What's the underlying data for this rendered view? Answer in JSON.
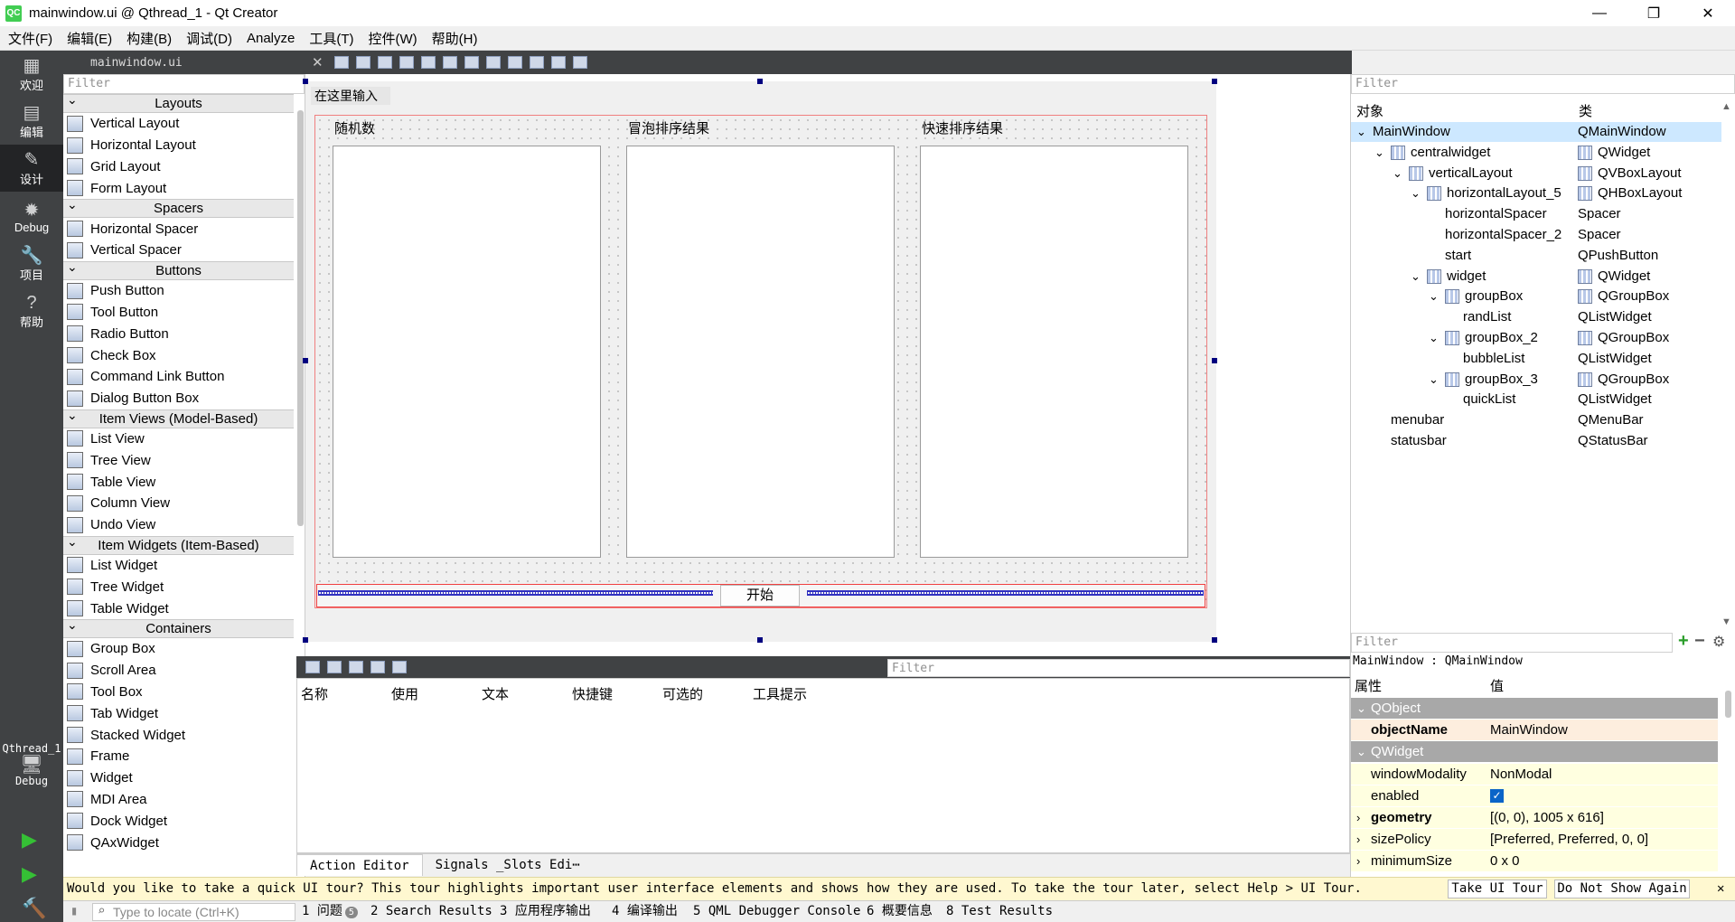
{
  "window": {
    "title": "mainwindow.ui @ Qthread_1 - Qt Creator",
    "app_icon": "QC",
    "controls": [
      "—",
      "❐",
      "✕"
    ]
  },
  "menu": [
    "文件(F)",
    "编辑(E)",
    "构建(B)",
    "调试(D)",
    "Analyze",
    "工具(T)",
    "控件(W)",
    "帮助(H)"
  ],
  "modes": [
    {
      "label": "欢迎",
      "icon": "grid-icon"
    },
    {
      "label": "编辑",
      "icon": "edit-icon"
    },
    {
      "label": "设计",
      "icon": "pencil-icon",
      "active": true
    },
    {
      "label": "Debug",
      "icon": "bug-icon"
    },
    {
      "label": "项目",
      "icon": "wrench-icon"
    },
    {
      "label": "帮助",
      "icon": "help-icon"
    }
  ],
  "kit": {
    "project": "Qthread_1",
    "build": "Debug"
  },
  "file_tab": {
    "name": "mainwindow.ui"
  },
  "widget_box": {
    "filter_placeholder": "Filter",
    "categories": [
      {
        "name": "Layouts",
        "items": [
          "Vertical Layout",
          "Horizontal Layout",
          "Grid Layout",
          "Form Layout"
        ]
      },
      {
        "name": "Spacers",
        "items": [
          "Horizontal Spacer",
          "Vertical Spacer"
        ]
      },
      {
        "name": "Buttons",
        "items": [
          "Push Button",
          "Tool Button",
          "Radio Button",
          "Check Box",
          "Command Link Button",
          "Dialog Button Box"
        ]
      },
      {
        "name": "Item Views (Model-Based)",
        "items": [
          "List View",
          "Tree View",
          "Table View",
          "Column View",
          "Undo View"
        ]
      },
      {
        "name": "Item Widgets (Item-Based)",
        "items": [
          "List Widget",
          "Tree Widget",
          "Table Widget"
        ]
      },
      {
        "name": "Containers",
        "items": [
          "Group Box",
          "Scroll Area",
          "Tool Box",
          "Tab Widget",
          "Stacked Widget",
          "Frame",
          "Widget",
          "MDI Area",
          "Dock Widget",
          "QAxWidget"
        ]
      }
    ]
  },
  "form": {
    "menubar_placeholder": "在这里输入",
    "groups": [
      "随机数",
      "冒泡排序结果",
      "快速排序结果"
    ],
    "start_button": "开始"
  },
  "action_editor": {
    "filter_placeholder": "Filter",
    "columns": [
      "名称",
      "使用",
      "文本",
      "快捷键",
      "可选的",
      "工具提示"
    ],
    "tabs": [
      "Action Editor",
      "Signals _Slots Edi⋯"
    ]
  },
  "object_inspector": {
    "filter_placeholder": "Filter",
    "headers": [
      "对象",
      "类"
    ],
    "rows": [
      {
        "name": "MainWindow",
        "cls": "QMainWindow",
        "selected": true
      },
      {
        "name": "centralwidget",
        "cls": "QWidget"
      },
      {
        "name": "verticalLayout",
        "cls": "QVBoxLayout"
      },
      {
        "name": "horizontalLayout_5",
        "cls": "QHBoxLayout"
      },
      {
        "name": "horizontalSpacer",
        "cls": "Spacer"
      },
      {
        "name": "horizontalSpacer_2",
        "cls": "Spacer"
      },
      {
        "name": "start",
        "cls": "QPushButton"
      },
      {
        "name": "widget",
        "cls": "QWidget"
      },
      {
        "name": "groupBox",
        "cls": "QGroupBox"
      },
      {
        "name": "randList",
        "cls": "QListWidget"
      },
      {
        "name": "groupBox_2",
        "cls": "QGroupBox"
      },
      {
        "name": "bubbleList",
        "cls": "QListWidget"
      },
      {
        "name": "groupBox_3",
        "cls": "QGroupBox"
      },
      {
        "name": "quickList",
        "cls": "QListWidget"
      },
      {
        "name": "menubar",
        "cls": "QMenuBar"
      },
      {
        "name": "statusbar",
        "cls": "QStatusBar"
      }
    ]
  },
  "property_editor": {
    "filter_placeholder": "Filter",
    "context": "MainWindow : QMainWindow",
    "headers": [
      "属性",
      "值"
    ],
    "rows": [
      {
        "name": "QObject",
        "value": "",
        "section": true
      },
      {
        "name": "objectName",
        "value": "MainWindow",
        "bold": true
      },
      {
        "name": "QWidget",
        "value": "",
        "section": true
      },
      {
        "name": "windowModality",
        "value": "NonModal"
      },
      {
        "name": "enabled",
        "value": ""
      },
      {
        "name": "geometry",
        "value": "[(0, 0), 1005 x 616]",
        "bold": true
      },
      {
        "name": "sizePolicy",
        "value": "[Preferred, Preferred, 0, 0]"
      },
      {
        "name": "minimumSize",
        "value": "0 x 0"
      }
    ]
  },
  "tour": {
    "message": "Would you like to take a quick UI tour? This tour highlights important user interface elements and shows how they are used. To take the tour later, select Help > UI Tour.",
    "take": "Take UI Tour",
    "dismiss": "Do Not Show Again"
  },
  "statusbar": {
    "locate_placeholder": "Type to locate (Ctrl+K)",
    "issues_count": "5",
    "panes": [
      "1 问题",
      "2 Search Results",
      "3 应用程序输出",
      "4 编译输出",
      "5 QML Debugger Console",
      "6 概要信息",
      "8 Test Results"
    ]
  }
}
